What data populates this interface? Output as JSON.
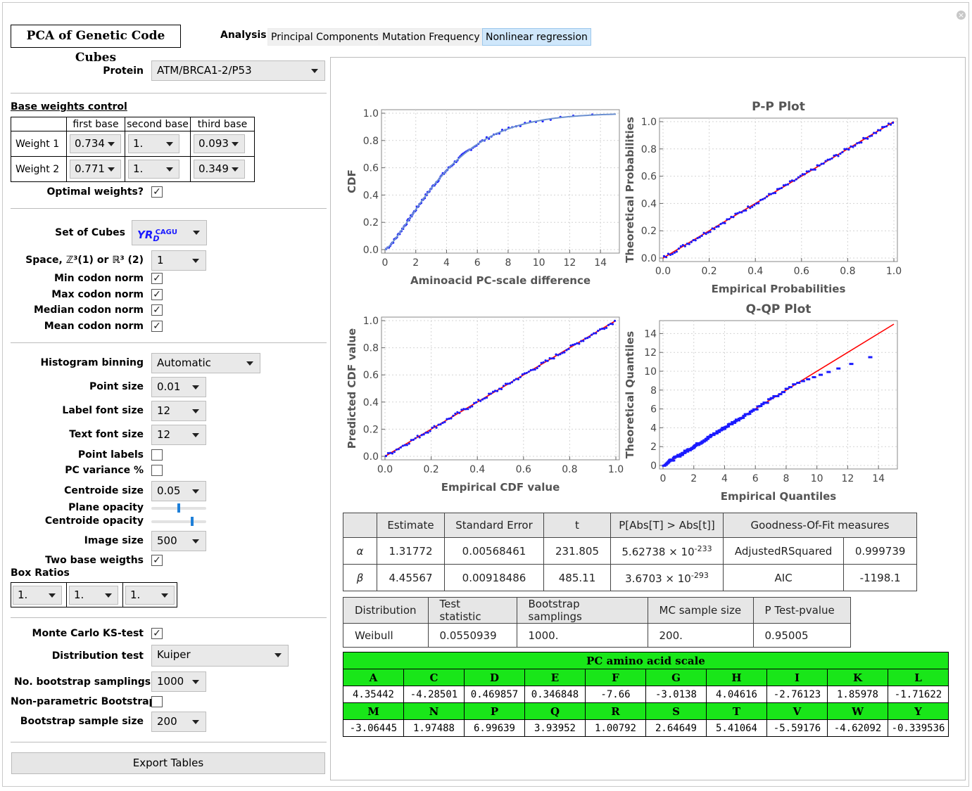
{
  "title": "PCA of Genetic Code Cubes",
  "analysis": {
    "label": "Analysis",
    "tabs": [
      "Principal Components",
      "Mutation Frequency",
      "Nonlinear regression"
    ],
    "active_tab": "Nonlinear regression"
  },
  "protein": {
    "label": "Protein",
    "value": "ATM/BRCA1-2/P53"
  },
  "base_weights": {
    "heading": "Base weights control",
    "columns": [
      "first base",
      "second base",
      "third base"
    ],
    "rows": [
      {
        "label": "Weight 1",
        "values": [
          "0.734",
          "1.",
          "0.093"
        ]
      },
      {
        "label": "Weight 2",
        "values": [
          "0.771",
          "1.",
          "0.349"
        ]
      }
    ],
    "optimal_label": "Optimal weights?",
    "optimal_checked": true
  },
  "cubes": {
    "set_label": "Set of Cubes",
    "set_value": "YR",
    "set_value_sub": "D",
    "set_value_sup": "CAGU",
    "space_label": "Space, ℤ³(1) or ℝ³ (2)",
    "space_value": "1",
    "norms": [
      {
        "label": "Min codon norm",
        "checked": true
      },
      {
        "label": "Max codon norm",
        "checked": true
      },
      {
        "label": "Median codon norm",
        "checked": true
      },
      {
        "label": "Mean codon norm",
        "checked": true
      }
    ]
  },
  "display": {
    "histogram_label": "Histogram binning",
    "histogram_value": "Automatic",
    "point_size_label": "Point size",
    "point_size_value": "0.01",
    "label_font_label": "Label font size",
    "label_font_value": "12",
    "text_font_label": "Text font size",
    "text_font_value": "12",
    "point_labels_label": "Point labels",
    "point_labels_checked": false,
    "pc_variance_label": "PC variance %",
    "pc_variance_checked": false,
    "centroide_size_label": "Centroide size",
    "centroide_size_value": "0.05",
    "plane_opacity_label": "Plane opacity",
    "plane_opacity": 0.5,
    "centroide_opacity_label": "Centroide opacity",
    "centroide_opacity": 0.75,
    "image_size_label": "Image size",
    "image_size_value": "500",
    "two_base_label": "Two base weigths",
    "two_base_checked": true,
    "box_ratios_label": "Box Ratios",
    "box_ratios": [
      "1.",
      "1.",
      "1."
    ]
  },
  "tests": {
    "mc_label": "Monte Carlo KS-test",
    "mc_checked": true,
    "dist_test_label": "Distribution test",
    "dist_test_value": "Kuiper",
    "bootstrap_label": "No. bootstrap samplings",
    "bootstrap_value": "1000",
    "nonparam_label": "Non-parametric Bootstrap?",
    "nonparam_checked": false,
    "sample_size_label": "Bootstrap sample size",
    "sample_size_value": "200"
  },
  "export_label": "Export Tables",
  "chart_data": [
    {
      "type": "line",
      "xlabel": "Aminoacid PC-scale difference",
      "ylabel": "CDF",
      "xlim": [
        0,
        15
      ],
      "ylim": [
        0,
        1
      ],
      "xticks": [
        "0",
        "2",
        "4",
        "6",
        "8",
        "10",
        "12",
        "14"
      ],
      "yticks": [
        "0.0",
        "0.2",
        "0.4",
        "0.6",
        "0.8",
        "1.0"
      ],
      "series": [
        {
          "kind": "points"
        },
        {
          "kind": "fitted"
        }
      ]
    },
    {
      "type": "scatter",
      "title": "P-P Plot",
      "xlabel": "Empirical Probabilities",
      "ylabel": "Theoretical Probabilities",
      "xlim": [
        0,
        1
      ],
      "ylim": [
        0,
        1
      ],
      "xticks": [
        "0.0",
        "0.2",
        "0.4",
        "0.6",
        "0.8",
        "1.0"
      ],
      "yticks": [
        "0.0",
        "0.2",
        "0.4",
        "0.6",
        "0.8",
        "1.0"
      ]
    },
    {
      "type": "scatter",
      "xlabel": "Empirical CDF value",
      "ylabel": "Predicted CDF value",
      "xlim": [
        0,
        1
      ],
      "ylim": [
        0,
        1
      ],
      "xticks": [
        "0.0",
        "0.2",
        "0.4",
        "0.6",
        "0.8",
        "1.0"
      ],
      "yticks": [
        "0.0",
        "0.2",
        "0.4",
        "0.6",
        "0.8",
        "1.0"
      ]
    },
    {
      "type": "scatter",
      "title": "Q-QP Plot",
      "xlabel": "Empirical Quantiles",
      "ylabel": "Theoretical Quantiles",
      "xlim": [
        0,
        15
      ],
      "ylim": [
        0,
        15
      ],
      "xticks": [
        "0",
        "2",
        "4",
        "6",
        "8",
        "10",
        "12",
        "14"
      ],
      "yticks": [
        "0",
        "2",
        "4",
        "6",
        "8",
        "10",
        "12",
        "14"
      ]
    }
  ],
  "estimates": {
    "headers": [
      "",
      "Estimate",
      "Standard Error",
      "t",
      "P[Abs[T] > Abs[t]]",
      "Goodness-Of-Fit measures"
    ],
    "rows": [
      {
        "param": "α",
        "estimate": "1.31772",
        "se": "0.00568461",
        "t": "231.805",
        "p_mant": "5.62738 × 10",
        "p_exp": "-233",
        "gof_name": "AdjustedRSquared",
        "gof_value": "0.999739"
      },
      {
        "param": "β",
        "estimate": "4.45567",
        "se": "0.00918486",
        "t": "485.11",
        "p_mant": "3.6703 × 10",
        "p_exp": "-293",
        "gof_name": "AIC",
        "gof_value": "-1198.1"
      }
    ]
  },
  "distribution": {
    "headers": [
      "Distribution",
      "Test statistic",
      "Bootstrap samplings",
      "MC sample size",
      "P Test-pvalue"
    ],
    "values": [
      "Weibull",
      "0.0550939",
      "1000.",
      "200.",
      "0.95005"
    ]
  },
  "aa_scale": {
    "title": "PC amino acid scale",
    "row1_letters": [
      "A",
      "C",
      "D",
      "E",
      "F",
      "G",
      "H",
      "I",
      "K",
      "L"
    ],
    "row1_values": [
      "4.35442",
      "-4.28501",
      "0.469857",
      "0.346848",
      "-7.66",
      "-3.0138",
      "4.04616",
      "-2.76123",
      "1.85978",
      "-1.71622"
    ],
    "row2_letters": [
      "M",
      "N",
      "P",
      "Q",
      "R",
      "S",
      "T",
      "V",
      "W",
      "Y"
    ],
    "row2_values": [
      "-3.06445",
      "1.97488",
      "6.99639",
      "3.93952",
      "1.00792",
      "2.64649",
      "5.41064",
      "-5.59176",
      "-4.62092",
      "-0.339536"
    ]
  },
  "colors": {
    "points": "#1a1aff",
    "fit_line": "#ff0000",
    "cdf_curve": "#6a8fd0",
    "active_tab": "#cfe7fb",
    "aa_header": "#19e619"
  }
}
